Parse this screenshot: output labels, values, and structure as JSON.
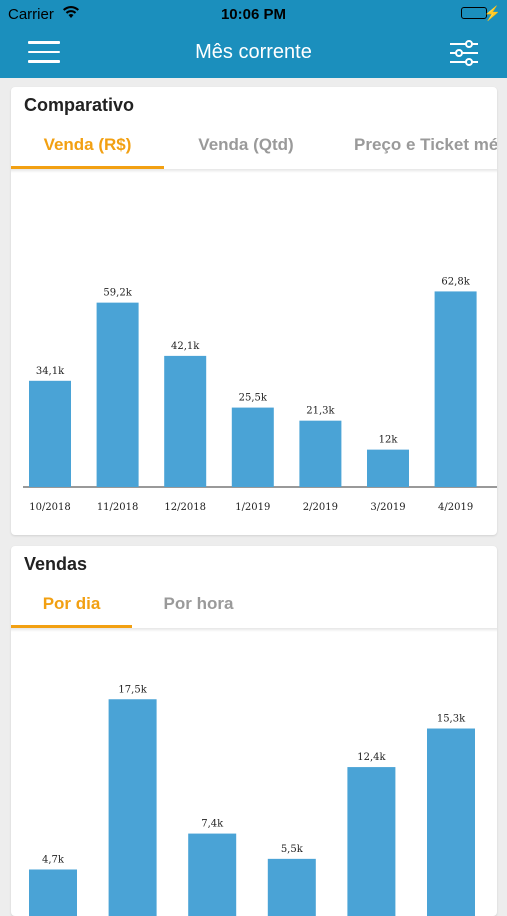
{
  "status_bar": {
    "carrier": "Carrier",
    "time": "10:06 PM"
  },
  "nav": {
    "title": "Mês corrente"
  },
  "comparativo": {
    "title": "Comparativo",
    "tabs": [
      "Venda (R$)",
      "Venda (Qtd)",
      "Preço e Ticket médio"
    ],
    "active_tab": 0
  },
  "vendas": {
    "title": "Vendas",
    "tabs": [
      "Por dia",
      "Por hora"
    ],
    "active_tab": 0
  },
  "colors": {
    "accent": "#f2a012",
    "brand": "#1b8fbd",
    "bar": "#4aa3d6"
  },
  "chart_data": [
    {
      "type": "bar",
      "categories": [
        "10/2018",
        "11/2018",
        "12/2018",
        "1/2019",
        "2/2019",
        "3/2019",
        "4/2019"
      ],
      "values": [
        34.1,
        59.2,
        42.1,
        25.5,
        21.3,
        12,
        62.8
      ],
      "data_labels": [
        "34,1k",
        "59,2k",
        "42,1k",
        "25,5k",
        "21,3k",
        "12k",
        "62,8k"
      ],
      "ylim": [
        0,
        70
      ]
    },
    {
      "type": "bar",
      "categories": [],
      "values": [
        4.7,
        17.5,
        7.4,
        5.5,
        12.4,
        15.3
      ],
      "data_labels": [
        "4,7k",
        "17,5k",
        "7,4k",
        "5,5k",
        "12,4k",
        "15,3k"
      ],
      "ylim": [
        0,
        20
      ]
    }
  ]
}
